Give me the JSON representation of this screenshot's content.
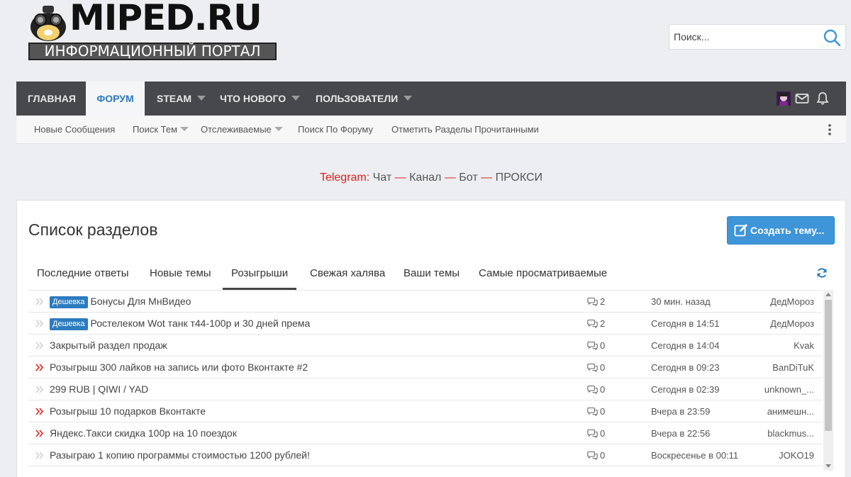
{
  "header": {
    "logo_text": "MIPED.RU",
    "logo_subtitle": "ИНФОРМАЦИОННЫЙ ПОРТАЛ",
    "search_placeholder": "Поиск..."
  },
  "nav": {
    "items": [
      {
        "label": "Главная",
        "caret": false,
        "active": false
      },
      {
        "label": "Форум",
        "caret": false,
        "active": true
      },
      {
        "label": "Steam",
        "caret": true,
        "active": false
      },
      {
        "label": "Что нового",
        "caret": true,
        "active": false
      },
      {
        "label": "Пользователи",
        "caret": true,
        "active": false
      }
    ],
    "right_icons": [
      "avatar",
      "mail-icon",
      "bell-icon"
    ]
  },
  "subnav": {
    "items": [
      {
        "label": "Новые Сообщения",
        "caret": false
      },
      {
        "label": "Поиск Тем",
        "caret": true
      },
      {
        "label": "Отслеживаемые",
        "caret": true
      },
      {
        "label": "Поиск По Форуму",
        "caret": false
      },
      {
        "label": "Отметить Разделы Прочитанными",
        "caret": false
      }
    ]
  },
  "telegram": {
    "label": "Telegram:",
    "links": [
      "Чат",
      "Канал",
      "Бот",
      "ПРОКСИ"
    ],
    "separator": "—"
  },
  "panel": {
    "title": "Список разделов",
    "create_button": "Создать тему...",
    "tabs": [
      {
        "label": "Последние ответы",
        "active": false
      },
      {
        "label": "Новые темы",
        "active": false
      },
      {
        "label": "Розыгрыши",
        "active": true
      },
      {
        "label": "Свежая халява",
        "active": false
      },
      {
        "label": "Ваши темы",
        "active": false
      },
      {
        "label": "Самые просматриваемые",
        "active": false
      }
    ],
    "rows": [
      {
        "badge": "Дешевка",
        "title": "Бонусы Для МнВидео",
        "replies": "2",
        "time": "30 мин. назад",
        "user": "ДедМороз",
        "hot": false
      },
      {
        "badge": "Дешевка",
        "title": "Ростелеком Wot танк т44-100р и 30 дней према",
        "replies": "2",
        "time": "Сегодня в 14:51",
        "user": "ДедМороз",
        "hot": false
      },
      {
        "badge": "",
        "title": "Закрытый раздел продаж",
        "replies": "0",
        "time": "Сегодня в 14:04",
        "user": "Kvak",
        "hot": false
      },
      {
        "badge": "",
        "title": "Розыгрыш 300 лайков на запись или фото Вконтакте #2",
        "replies": "0",
        "time": "Сегодня в 09:23",
        "user": "BanDiTuK",
        "hot": true
      },
      {
        "badge": "",
        "title": "299 RUB | QIWI / YAD",
        "replies": "0",
        "time": "Сегодня в 02:39",
        "user": "unknown_...",
        "hot": false
      },
      {
        "badge": "",
        "title": "Розыгрыш 10 подарков Вконтакте",
        "replies": "0",
        "time": "Вчера в 23:59",
        "user": "анимешн...",
        "hot": true
      },
      {
        "badge": "",
        "title": "Яндекс.Такси скидка 100р на 10 поездок",
        "replies": "0",
        "time": "Вчера в 22:56",
        "user": "blackmus...",
        "hot": true
      },
      {
        "badge": "",
        "title": "Разыграю 1 копию программы стоимостью 1200 рублей!",
        "replies": "0",
        "time": "Воскресенье в 00:11",
        "user": "JOKO19",
        "hot": false
      }
    ]
  },
  "colors": {
    "accent": "#2b7bbf",
    "nav_bg": "#46484b",
    "button_bg": "#3e95d8",
    "hot_marker": "#d9221c",
    "telegram_label": "#d9221c"
  }
}
